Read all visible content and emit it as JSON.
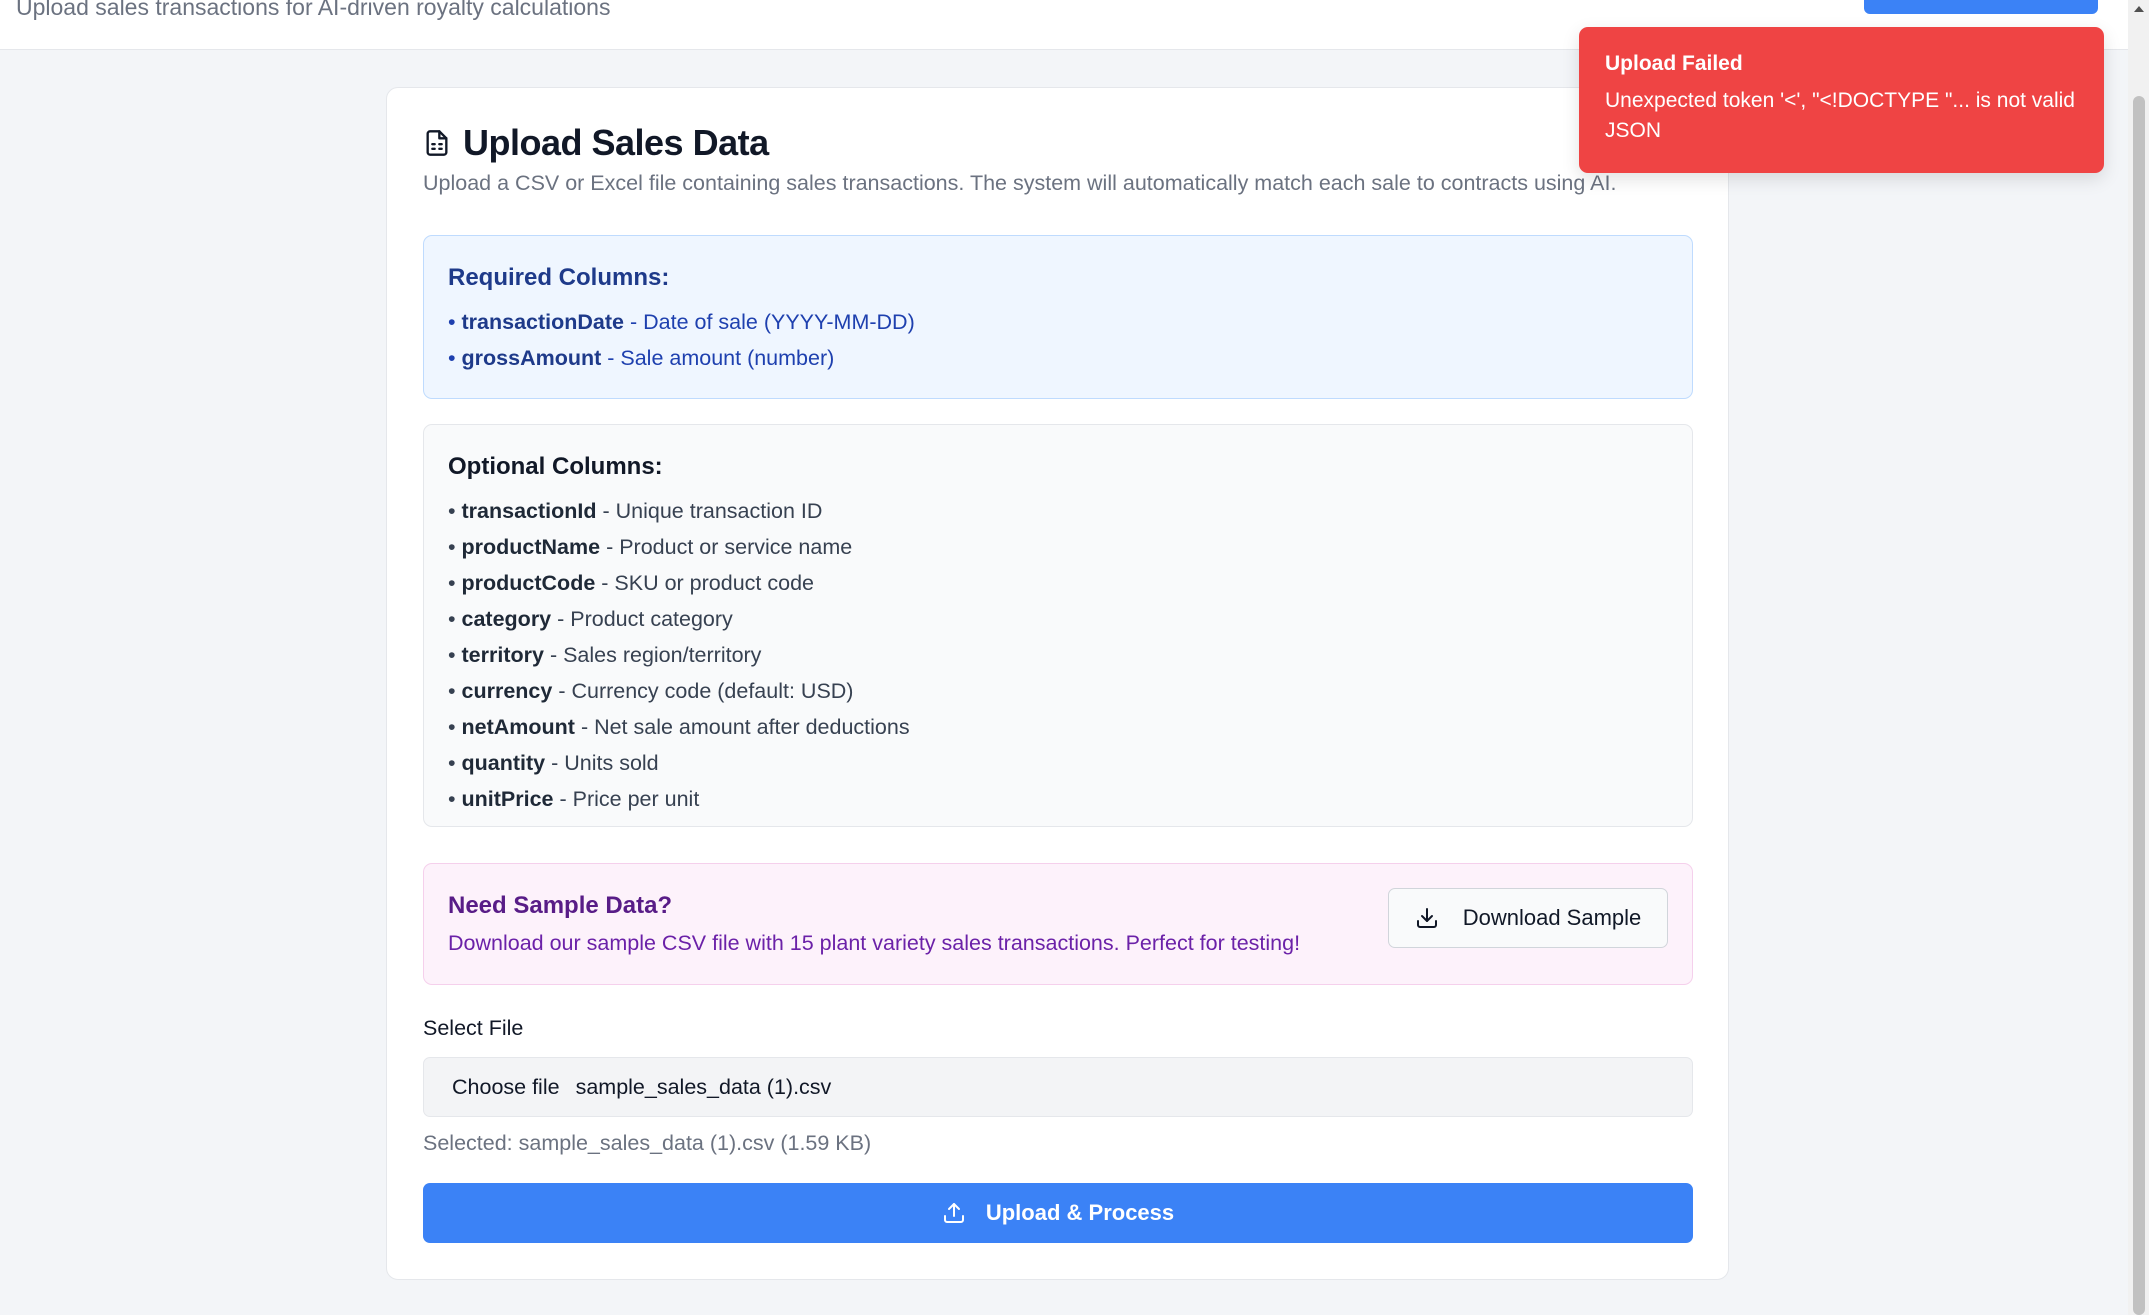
{
  "header": {
    "subtitle": "Upload sales transactions for AI-driven royalty calculations"
  },
  "card": {
    "title": "Upload Sales Data",
    "description": "Upload a CSV or Excel file containing sales transactions. The system will automatically match each sale to contracts using AI.",
    "title_icon": "document-icon"
  },
  "required": {
    "heading": "Required Columns:",
    "items": [
      {
        "bullet": "• ",
        "name": "transactionDate",
        "desc": " - Date of sale (YYYY-MM-DD)"
      },
      {
        "bullet": "• ",
        "name": "grossAmount",
        "desc": " - Sale amount (number)"
      }
    ]
  },
  "optional": {
    "heading": "Optional Columns:",
    "items": [
      {
        "bullet": "• ",
        "name": "transactionId",
        "desc": " - Unique transaction ID"
      },
      {
        "bullet": "• ",
        "name": "productName",
        "desc": " - Product or service name"
      },
      {
        "bullet": "• ",
        "name": "productCode",
        "desc": " - SKU or product code"
      },
      {
        "bullet": "• ",
        "name": "category",
        "desc": " - Product category"
      },
      {
        "bullet": "• ",
        "name": "territory",
        "desc": " - Sales region/territory"
      },
      {
        "bullet": "• ",
        "name": "currency",
        "desc": " - Currency code (default: USD)"
      },
      {
        "bullet": "• ",
        "name": "netAmount",
        "desc": " - Net sale amount after deductions"
      },
      {
        "bullet": "• ",
        "name": "quantity",
        "desc": " - Units sold"
      },
      {
        "bullet": "• ",
        "name": "unitPrice",
        "desc": " - Price per unit"
      }
    ]
  },
  "sample": {
    "heading": "Need Sample Data?",
    "description": "Download our sample CSV file with 15 plant variety sales transactions. Perfect for testing!",
    "button_label": "Download Sample"
  },
  "file": {
    "label": "Select File",
    "choose_label": "Choose file",
    "file_name": "sample_sales_data (1).csv",
    "selected_text": "Selected: sample_sales_data (1).csv (1.59 KB)"
  },
  "upload": {
    "button_label": "Upload & Process"
  },
  "toast": {
    "title": "Upload Failed",
    "message": "Unexpected token '<', \"<!DOCTYPE \"... is not valid JSON"
  },
  "colors": {
    "primary": "#3b82f6",
    "error": "#ef4444",
    "required_bg": "#eff6ff",
    "sample_bg": "#fdf2fb"
  }
}
